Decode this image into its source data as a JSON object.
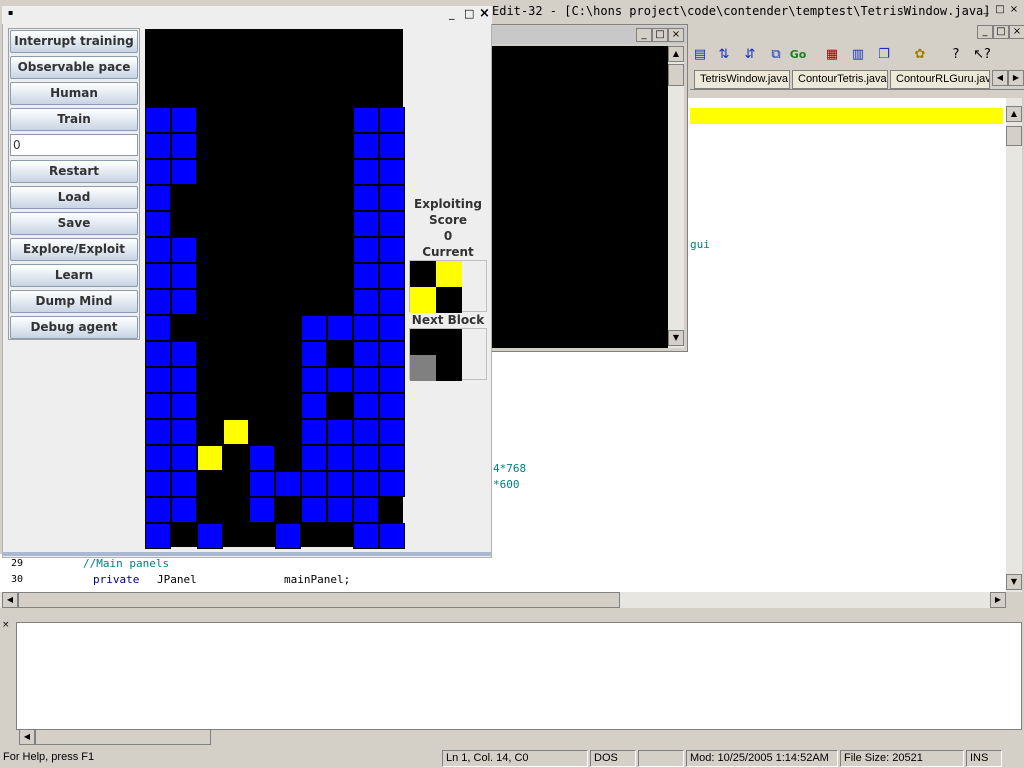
{
  "editor": {
    "title": "Edit-32 - [C:\\hons project\\code\\contender\\temptest\\TetrisWindow.java]",
    "window_buttons": [
      "_",
      "□",
      "×"
    ],
    "mdi_buttons": [
      "_",
      "□",
      "×"
    ],
    "toolbar_icons": [
      "tile-horizontal-icon",
      "build-icon",
      "run-icon",
      "class-browser-icon",
      "go-icon",
      "window-icon",
      "window-2-icon",
      "cascade-icon",
      "project-icon",
      "help-icon",
      "context-help-icon"
    ],
    "file_tabs": [
      "TetrisWindow.java",
      "ContourTetris.java",
      "ContourRLGuru.jav"
    ],
    "code_fragments": [
      "gui",
      "4*768",
      "*600"
    ],
    "code_lines": [
      {
        "num": "29",
        "text": "        //Main panels"
      },
      {
        "num": "30",
        "keyword": "private",
        "type": "JPanel",
        "name": "mainPanel;"
      }
    ]
  },
  "status": {
    "help": "For Help, press F1",
    "position": "Ln 1, Col. 14, C0",
    "format": "DOS",
    "modified": "Mod: 10/25/2005 1:14:52AM",
    "file_size": "File Size: 20521",
    "mode": "INS"
  },
  "tetris": {
    "title_icon": "java-cup-icon",
    "buttons": [
      "Interrupt training",
      "Observable pace",
      "Human",
      "Train",
      "Restart",
      "Load",
      "Save",
      "Explore/Exploit",
      "Learn",
      "Dump Mind",
      "Debug agent"
    ],
    "episodes_value": "0",
    "mode_label": "Exploiting",
    "score_label": "Score",
    "score_value": "0",
    "current_block_label": "Current Block",
    "next_block_label": "Next Block",
    "colors": {
      "blue": "#0000ff",
      "yellow": "#ffff00",
      "gray": "#808080",
      "black": "#000000"
    },
    "board_rows": [
      "..........",
      "..........",
      "..........",
      "BB......BB",
      "BB......BB",
      "BB......BB",
      "B.......BB",
      "B.......BB",
      "BB......BB",
      "BB......BB",
      "BB......BB",
      "B.....BBBB",
      "BB....B.BB",
      "BB....BBBB",
      "BB....B.BB",
      "BB.Y..BBBB",
      "BBY.B.BBBB",
      "BB..BBBBBB",
      "BB..B.BBB.",
      "B.B..B..BB"
    ],
    "current_block": [
      "KY.",
      "YK."
    ],
    "next_block": [
      "KK.",
      "GK."
    ]
  }
}
